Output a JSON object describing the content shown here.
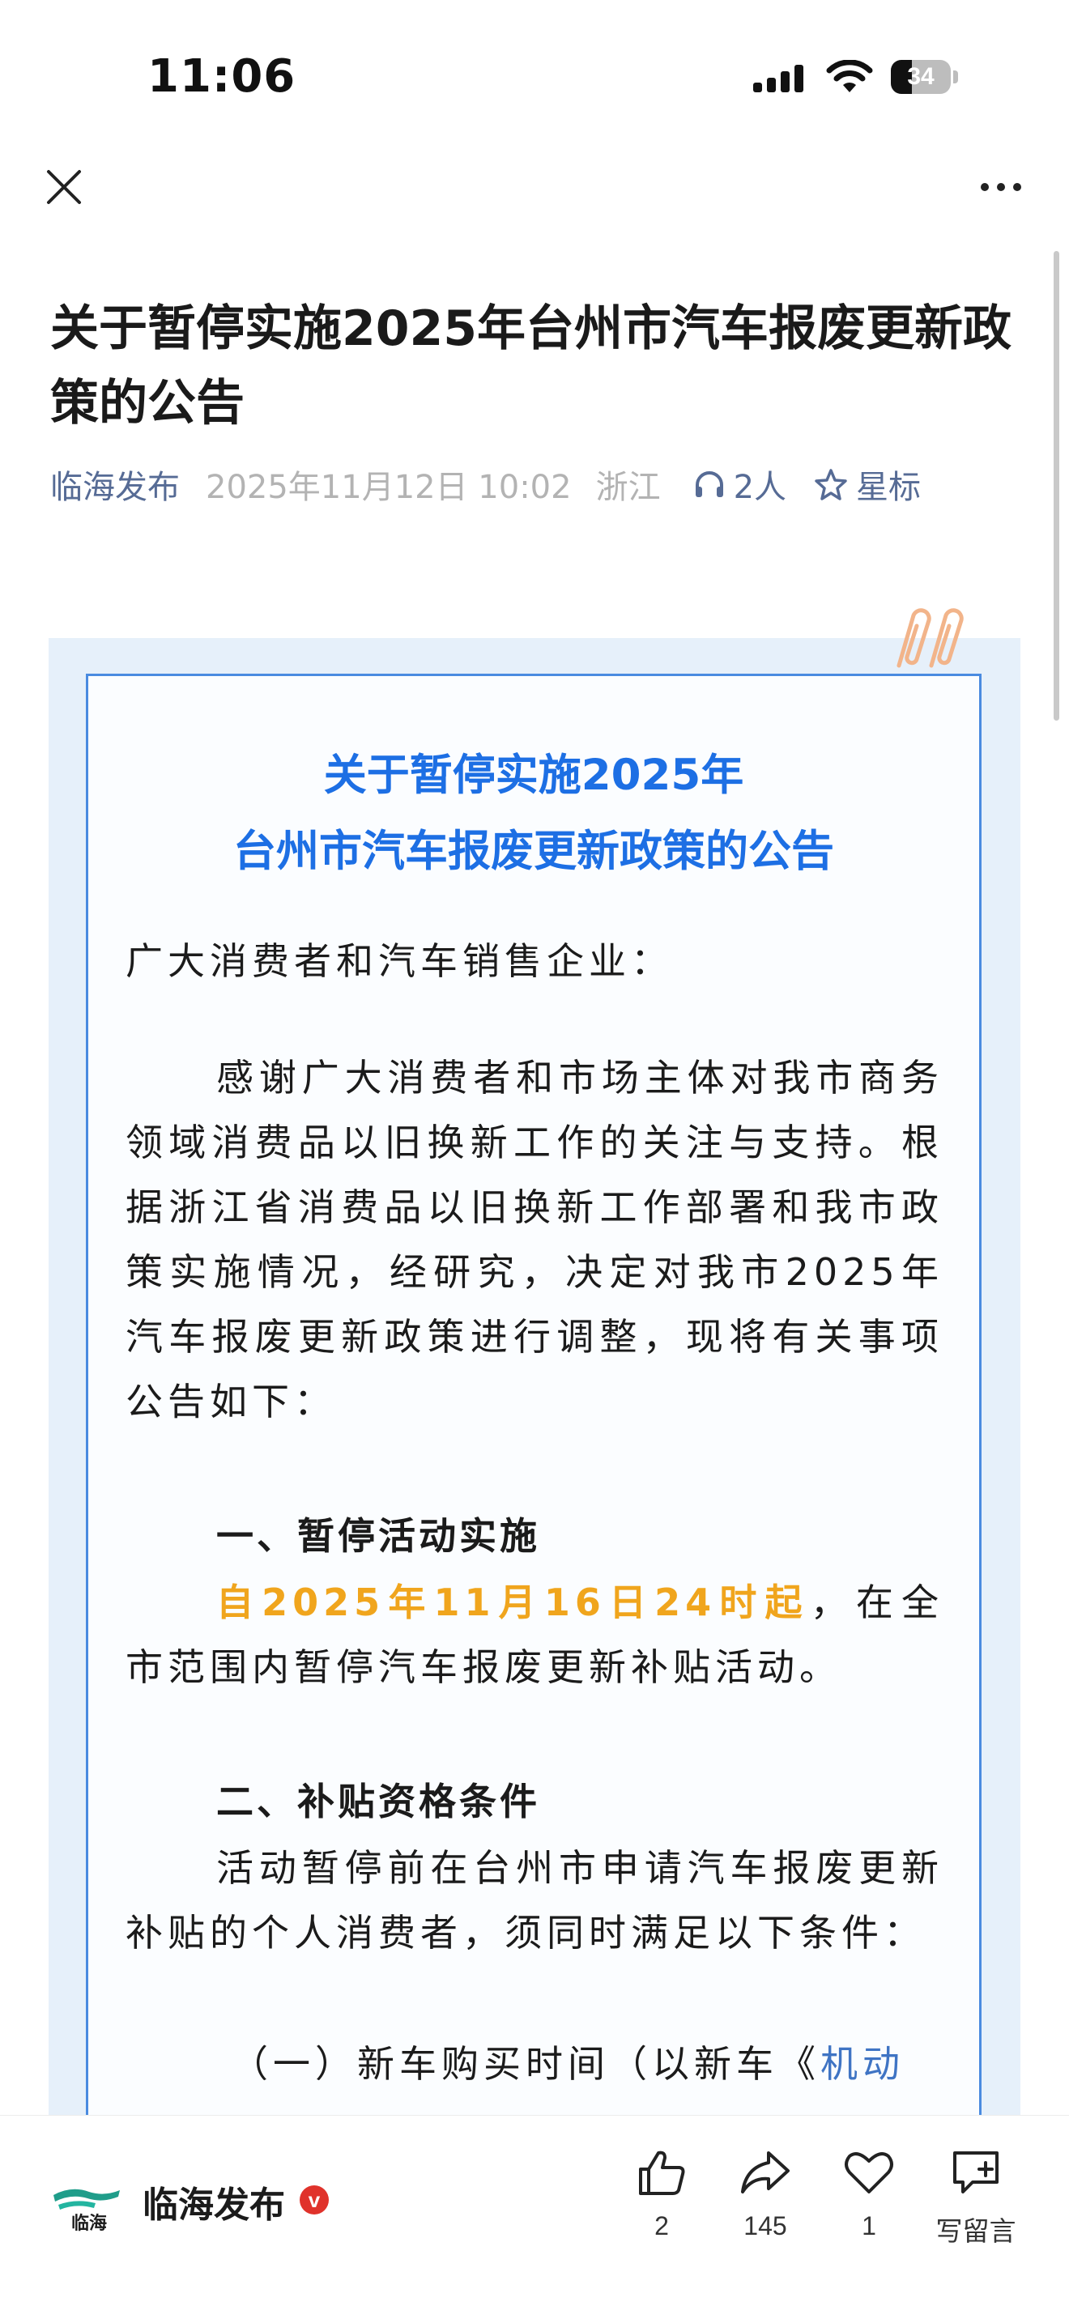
{
  "status_bar": {
    "time": "11:06",
    "battery_level": "34",
    "icons": [
      "signal-icon",
      "wifi-icon",
      "battery-icon"
    ]
  },
  "nav": {
    "icons": [
      "close-icon",
      "more-icon"
    ]
  },
  "article": {
    "title": "关于暂停实施2025年台州市汽车报废更新政策的公告",
    "author": "临海发布",
    "date": "2025年11月12日 10:02",
    "region": "浙江",
    "listeners": "2人",
    "star_label": "星标",
    "listen_icon": "headphones-icon",
    "star_icon": "star-icon"
  },
  "poster": {
    "title_line1": "关于暂停实施2025年",
    "title_line2": "台州市汽车报废更新政策的公告",
    "salutation": "广大消费者和汽车销售企业：",
    "para1": "感谢广大消费者和市场主体对我市商务领域消费品以旧换新工作的关注与支持。根据浙江省消费品以旧换新工作部署和我市政策实施情况，经研究，决定对我市2025年汽车报废更新政策进行调整，现将有关事项公告如下：",
    "section1_heading": "一、暂停活动实施",
    "section1_highlight": "自2025年11月16日24时起",
    "section1_rest": "，在全市范围内暂停汽车报废更新补贴活动。",
    "section2_heading": "二、补贴资格条件",
    "section2_text": "活动暂停前在台州市申请汽车报废更新补贴的个人消费者，须同时满足以下条件：",
    "item1_prefix": "（一）新车购买时间（以新车《",
    "item1_link": "机动",
    "accent_color": "#1d6fe4",
    "highlight_color": "#f0a51d"
  },
  "bottom_bar": {
    "account_name": "临海发布",
    "verified_mark": "v",
    "logo_text": "临海",
    "likes": "2",
    "shares": "145",
    "favorites": "1",
    "comment_label": "写留言",
    "icons": [
      "thumbs-up-icon",
      "share-icon",
      "heart-icon",
      "comment-icon"
    ]
  }
}
